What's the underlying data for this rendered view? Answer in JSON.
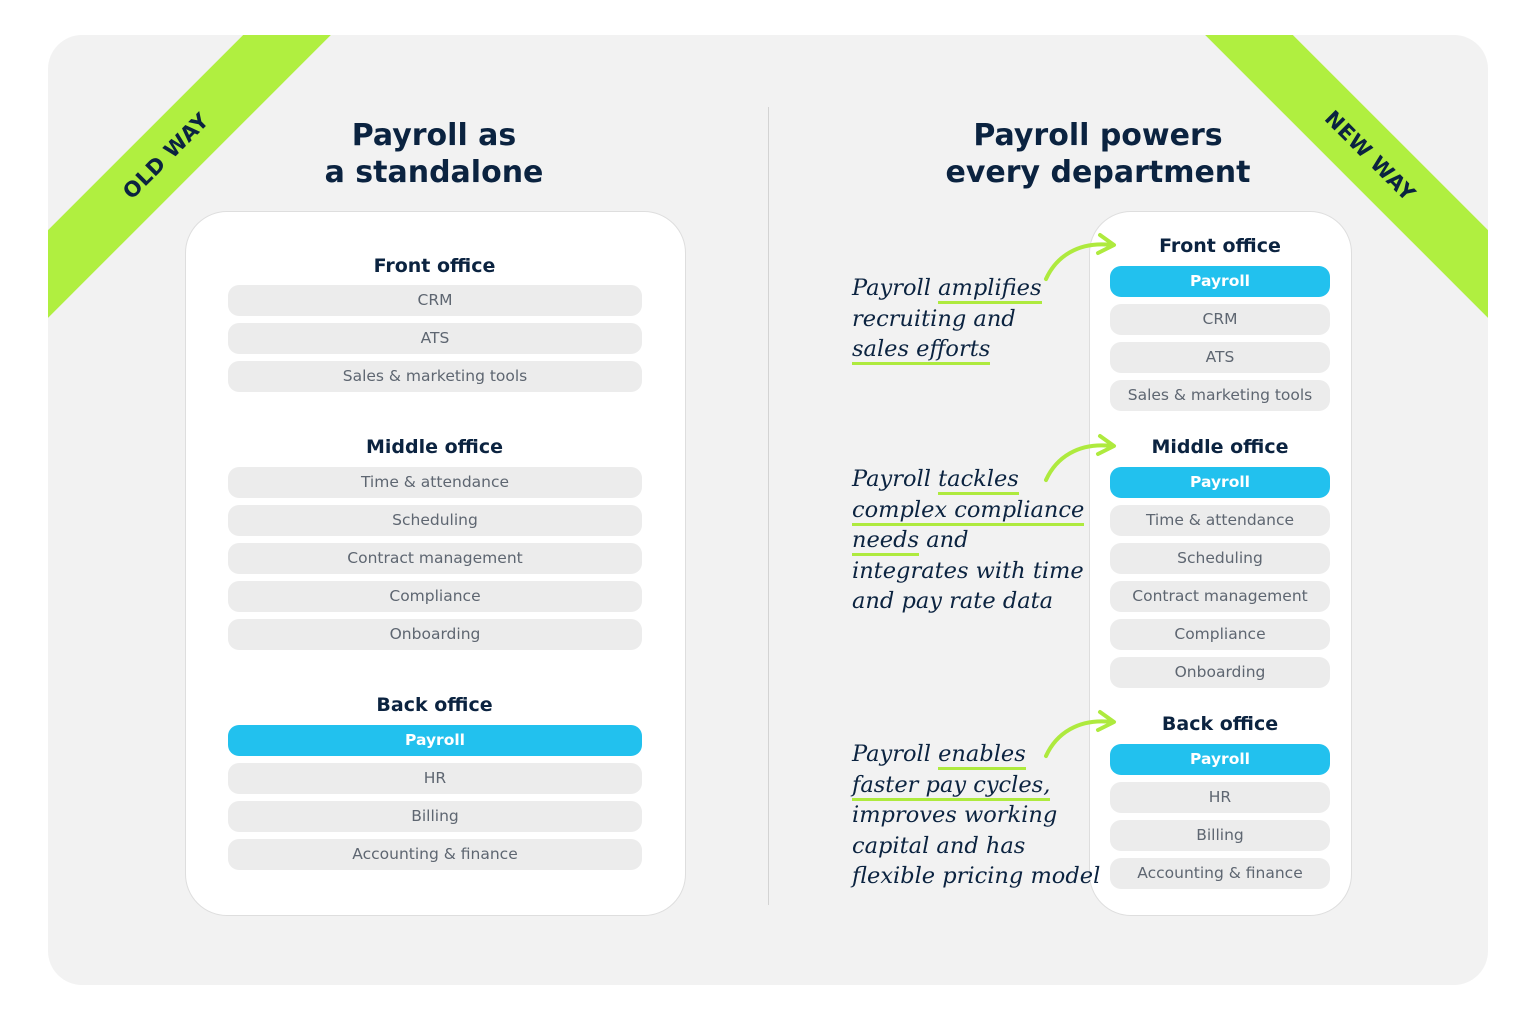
{
  "colors": {
    "ribbon": "#b0ef40",
    "navy": "#0b2340",
    "accent_pill": "#22c1ee",
    "neutral_pill": "#ececec",
    "panel": "#f2f2f2",
    "underline": "#aeea3e"
  },
  "old_way": {
    "ribbon_label": "OLD WAY",
    "title_line1": "Payroll as",
    "title_line2": "a standalone",
    "sections": [
      {
        "title": "Front office",
        "items": [
          "CRM",
          "ATS",
          "Sales & marketing tools"
        ]
      },
      {
        "title": "Middle office",
        "items": [
          "Time & attendance",
          "Scheduling",
          "Contract management",
          "Compliance",
          "Onboarding"
        ]
      },
      {
        "title": "Back office",
        "items": [
          "Payroll",
          "HR",
          "Billing",
          "Accounting & finance"
        ],
        "highlighted": "Payroll"
      }
    ]
  },
  "new_way": {
    "ribbon_label": "NEW WAY",
    "title_line1": "Payroll powers",
    "title_line2": "every department",
    "sections": [
      {
        "title": "Front office",
        "items": [
          "Payroll",
          "CRM",
          "ATS",
          "Sales & marketing tools"
        ],
        "highlighted": "Payroll"
      },
      {
        "title": "Middle office",
        "items": [
          "Payroll",
          "Time & attendance",
          "Scheduling",
          "Contract management",
          "Compliance",
          "Onboarding"
        ],
        "highlighted": "Payroll"
      },
      {
        "title": "Back office",
        "items": [
          "Payroll",
          "HR",
          "Billing",
          "Accounting & finance"
        ],
        "highlighted": "Payroll"
      }
    ],
    "notes": [
      {
        "parts": [
          "Payroll ",
          "amplifies",
          "recruiting and",
          "sales efforts"
        ]
      },
      {
        "parts": [
          "Payroll ",
          "tackles",
          "complex compliance",
          "needs",
          " and",
          "integrates with time",
          "and pay rate data"
        ]
      },
      {
        "parts": [
          "Payroll ",
          "enables",
          "faster pay cycles,",
          "improves working",
          "capital and has",
          "flexible pricing model"
        ]
      }
    ]
  }
}
